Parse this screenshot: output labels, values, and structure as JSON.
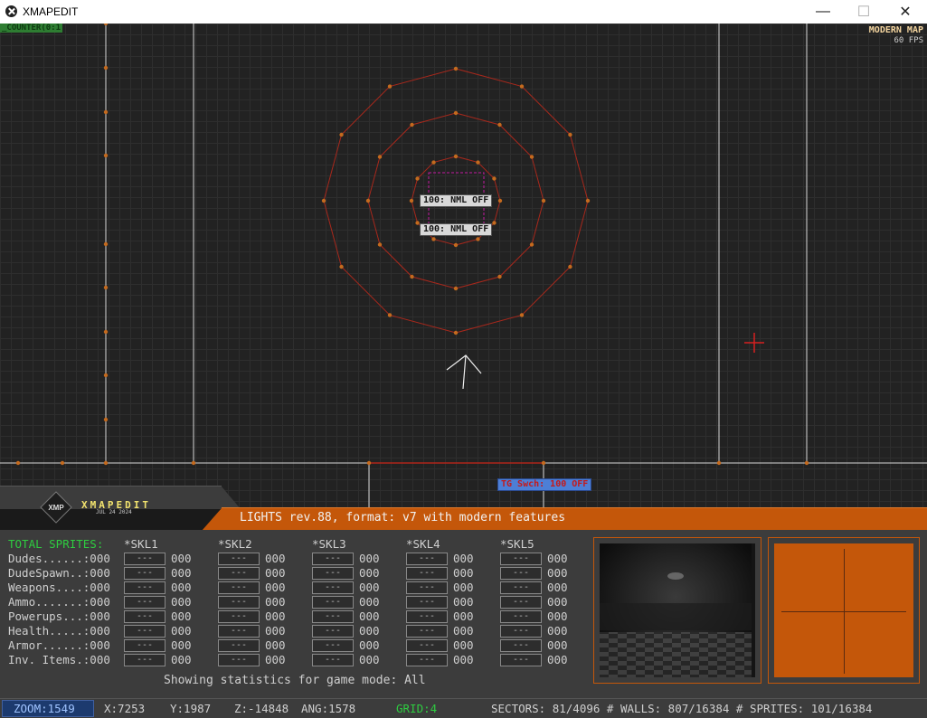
{
  "window": {
    "title": "XMAPEDIT",
    "min_label": "—",
    "max_label": "☐",
    "close_label": "✕"
  },
  "map": {
    "counter_tag": "_COUNTER(0:1",
    "mode_label": "MODERN MAP",
    "fps_label": "60 FPS",
    "light_tag_1": "100: NML OFF",
    "light_tag_2": "100: NML OFF",
    "trigger_tag": "TG Swch: 100 OFF"
  },
  "brand": {
    "name": "XMAPEDIT",
    "date": "JUL 24 2024",
    "logo_text": "XMP"
  },
  "info_bar": "LIGHTS rev.88, format: v7 with modern features",
  "stats": {
    "total_header": "TOTAL SPRITES:",
    "skill_headers": [
      "*SKL1",
      "*SKL2",
      "*SKL3",
      "*SKL4",
      "*SKL5"
    ],
    "rows": [
      {
        "label": "Dudes......:000"
      },
      {
        "label": "DudeSpawn..:000"
      },
      {
        "label": "Weapons....:000"
      },
      {
        "label": "Ammo.......:000"
      },
      {
        "label": "Powerups...:000"
      },
      {
        "label": "Health.....:000"
      },
      {
        "label": "Armor......:000"
      },
      {
        "label": "Inv. Items.:000"
      }
    ],
    "cell_box": "---",
    "cell_value": "000",
    "game_mode_text": "Showing statistics for game mode: All"
  },
  "status": {
    "zoom": "ZOOM:1549",
    "x": "X:7253",
    "y": "Y:1987",
    "z": "Z:-14848",
    "ang": "ANG:1578",
    "grid": "GRID:4",
    "counts": "SECTORS: 81/4096 # WALLS: 807/16384 # SPRITES: 101/16384"
  },
  "colors": {
    "accent": "#c4570a",
    "wall": "#b0251a",
    "vertex": "#c46a1e",
    "grid_text": "#2ecc40"
  }
}
